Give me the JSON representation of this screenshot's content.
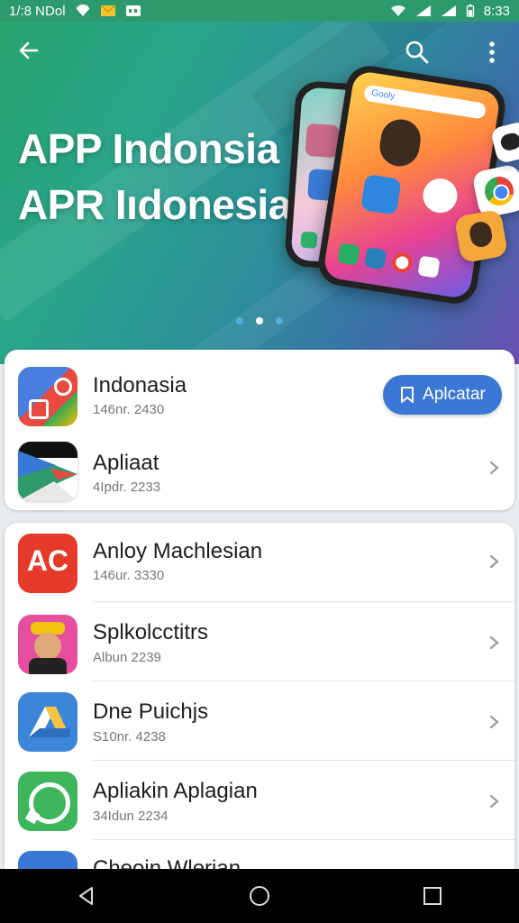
{
  "status_bar": {
    "left_text": "1/:8 NDol",
    "time": "8:33",
    "icons": [
      "location-icon",
      "mail-icon",
      "message-icon",
      "wifi-icon",
      "signal-icon",
      "signal-icon",
      "battery-icon"
    ]
  },
  "hero": {
    "title_line1": "APP Indonsia",
    "title_line2": "APR Iıdonesia",
    "carousel_pages": 3,
    "carousel_active": 2,
    "phone_brand": "Gooly"
  },
  "colors": {
    "accent": "#3b78d6",
    "hero_start": "#27a46f",
    "hero_end": "#6b4fb0"
  },
  "featured_card": {
    "items": [
      {
        "title": "Indonasia",
        "subtitle": "146nr. 2430",
        "icon": "maps-app-icon",
        "action_label": "Aplcatar"
      },
      {
        "title": "Apliaat",
        "subtitle": "4Ipdr. 2233",
        "icon": "play-store-icon"
      }
    ]
  },
  "list_card": {
    "items": [
      {
        "title": "Anloy Machlesian",
        "subtitle": "146ur. 3330",
        "icon": "ac-app-icon",
        "icon_text": "AC"
      },
      {
        "title": "Splkolcctitrs",
        "subtitle": "Albun 2239",
        "icon": "avatar-app-icon"
      },
      {
        "title": "Dne Puichjs",
        "subtitle": "S10nr. 4238",
        "icon": "drive-app-icon"
      },
      {
        "title": "Apliakin Aplagian",
        "subtitle": "34Idun 2234",
        "icon": "whatsapp-app-icon"
      },
      {
        "title": "Cheoin Wlerian",
        "subtitle": "",
        "icon": "blue-app-icon"
      }
    ]
  }
}
